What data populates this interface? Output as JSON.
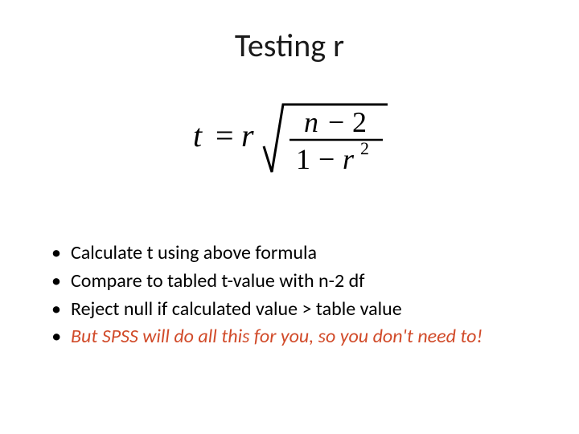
{
  "title": "Testing r",
  "formula": {
    "lhs_var": "t",
    "equals": "=",
    "rhs_coef": "r",
    "frac_num_left": "n",
    "frac_num_op": "−",
    "frac_num_right": "2",
    "frac_den_left": "1",
    "frac_den_op": "−",
    "frac_den_var": "r",
    "frac_den_exp": "2"
  },
  "bullets": [
    {
      "text": "Calculate t using above formula",
      "emph": false
    },
    {
      "text": "Compare to tabled t-value with n-2 df",
      "emph": false
    },
    {
      "text": "Reject null if calculated value > table value",
      "emph": false
    },
    {
      "text": "But SPSS will do all this for you, so you don't need to!",
      "emph": true
    }
  ]
}
